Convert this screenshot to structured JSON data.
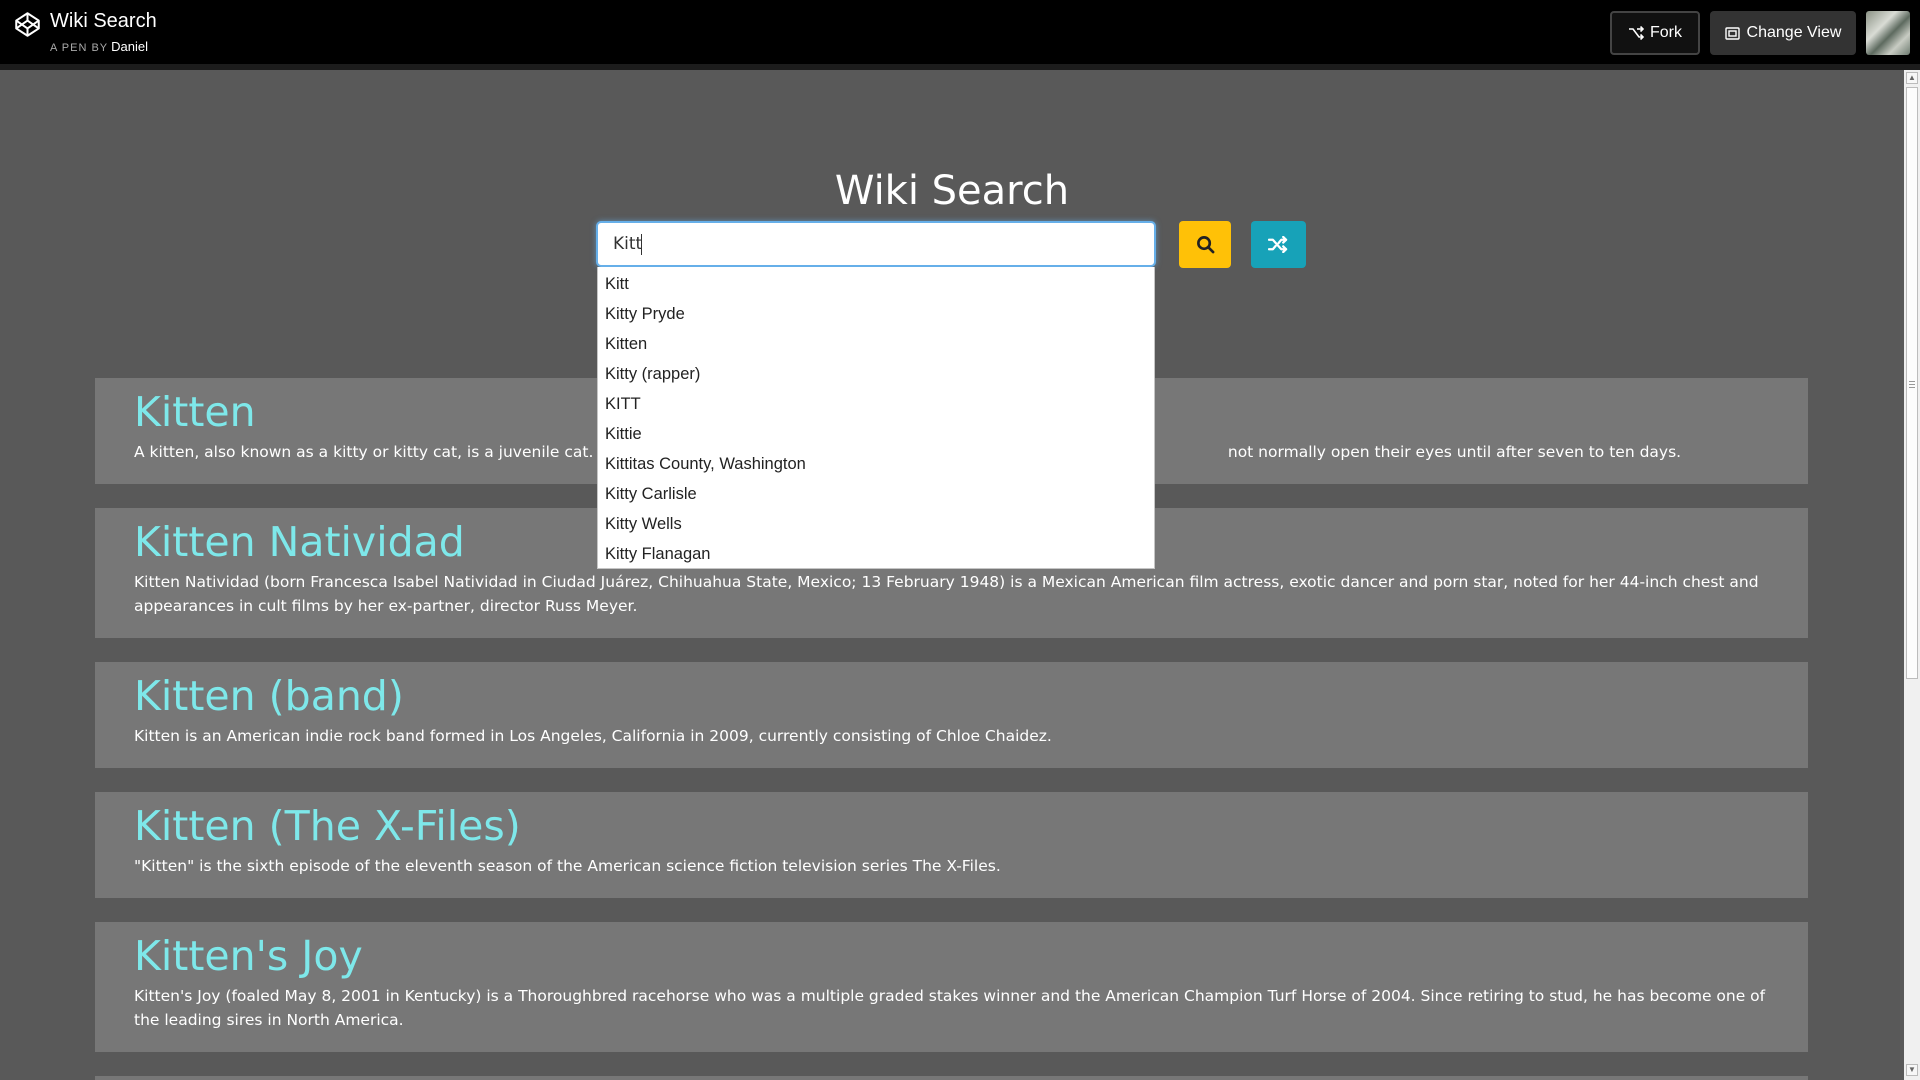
{
  "header": {
    "title": "Wiki Search",
    "by_label": "A PEN BY",
    "author": "Daniel",
    "fork_label": "Fork",
    "change_view_label": "Change View"
  },
  "app": {
    "title": "Wiki Search",
    "search_value": "Kitt"
  },
  "autocomplete": [
    "Kitt",
    "Kitty Pryde",
    "Kitten",
    "Kitty (rapper)",
    "KITT",
    "Kittie",
    "Kittitas County, Washington",
    "Kitty Carlisle",
    "Kitty Wells",
    "Kitty Flanagan"
  ],
  "results": [
    {
      "title": "Kitten",
      "snippet_visible_start": "A kitten, also known as a kitty or kitty cat, is a juvenile cat. After be",
      "snippet_visible_end": "not normally open their eyes until after seven to ten days."
    },
    {
      "title": "Kitten Natividad",
      "snippet": "Kitten Natividad (born Francesca Isabel Natividad in Ciudad Juárez, Chihuahua State, Mexico; 13 February 1948) is a Mexican American film actress, exotic dancer and porn star, noted for her 44-inch chest and appearances in cult films by her ex-partner, director Russ Meyer."
    },
    {
      "title": "Kitten (band)",
      "snippet": "Kitten is an American indie rock band formed in Los Angeles, California in 2009, currently consisting of Chloe Chaidez."
    },
    {
      "title": "Kitten (The X-Files)",
      "snippet": "\"Kitten\" is the sixth episode of the eleventh season of the American science fiction television series The X-Files."
    },
    {
      "title": "Kitten's Joy",
      "snippet": "Kitten's Joy (foaled May 8, 2001 in Kentucky) is a Thoroughbred racehorse who was a multiple graded stakes winner and the American Champion Turf Horse of 2004. Since retiring to stud, he has become one of the leading sires in North America."
    }
  ],
  "icons": {
    "logo": "codepen-logo-icon",
    "fork": "fork-icon",
    "change_view": "change-view-icon",
    "search": "search-icon",
    "random": "shuffle-icon"
  },
  "colors": {
    "page_background": "#595959",
    "card_background": "#777777",
    "result_title": "#7ee8ea",
    "search_button": "#ffc107",
    "random_button": "#17a2b8",
    "header_background": "#000000"
  }
}
